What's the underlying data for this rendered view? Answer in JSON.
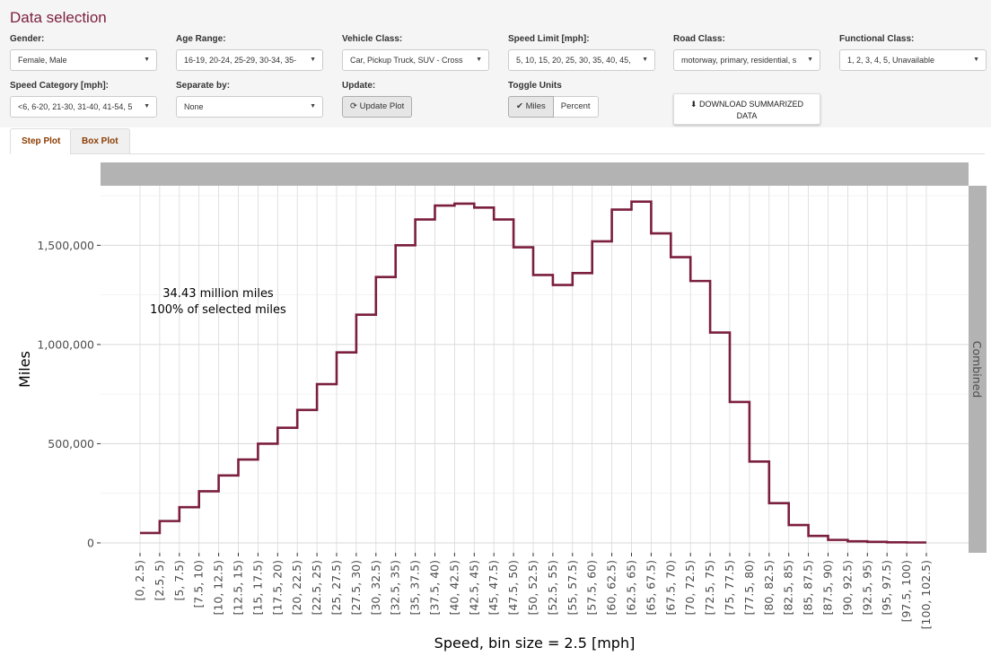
{
  "panel": {
    "title": "Data selection",
    "controls": [
      {
        "label": "Gender:",
        "value": "Female, Male"
      },
      {
        "label": "Age Range:",
        "value": "16-19, 20-24, 25-29, 30-34, 35-"
      },
      {
        "label": "Vehicle Class:",
        "value": "Car, Pickup Truck, SUV - Cross"
      },
      {
        "label": "Speed Limit [mph]:",
        "value": "5, 10, 15, 20, 25, 30, 35, 40, 45,"
      },
      {
        "label": "Road Class:",
        "value": "motorway, primary, residential, s"
      },
      {
        "label": "Functional Class:",
        "value": "1, 2, 3, 4, 5, Unavailable"
      },
      {
        "label": "Speed Category [mph]:",
        "value": "<6, 6-20, 21-30, 31-40, 41-54, 5"
      },
      {
        "label": "Separate by:",
        "value": "None"
      }
    ],
    "update_label": "Update:",
    "update_button": "Update Plot",
    "toggle_label": "Toggle Units",
    "toggle_options": [
      "Miles",
      "Percent"
    ],
    "download_button_line1": "DOWNLOAD SUMMARIZED",
    "download_button_line2": "DATA"
  },
  "tabs": [
    "Step Plot",
    "Box Plot"
  ],
  "icons": {
    "caret": "caret-down-icon",
    "refresh": "refresh-icon",
    "check": "check-icon",
    "download": "download-icon"
  },
  "colors": {
    "accent": "#7b1f3e",
    "line": "#7b1f3e",
    "strip": "#b3b3b3",
    "grid": "#d9d9d9"
  },
  "chart_data": {
    "type": "line",
    "step": true,
    "xlabel": "Speed, bin size = 2.5 [mph]",
    "ylabel": "Miles",
    "facet_label": "Combined",
    "annotation": [
      "34.43 million miles",
      "100% of selected miles"
    ],
    "ylim": [
      -50000,
      1800000
    ],
    "yticks": [
      0,
      500000,
      1000000,
      1500000
    ],
    "ytick_labels": [
      "0",
      "500,000",
      "1,000,000",
      "1,500,000"
    ],
    "categories": [
      "[0, 2.5)",
      "[2.5, 5)",
      "[5, 7.5)",
      "[7.5, 10)",
      "[10, 12.5)",
      "[12.5, 15)",
      "[15, 17.5)",
      "[17.5, 20)",
      "[20, 22.5)",
      "[22.5, 25)",
      "[25, 27.5)",
      "[27.5, 30)",
      "[30, 32.5)",
      "[32.5, 35)",
      "[35, 37.5)",
      "[37.5, 40)",
      "[40, 42.5)",
      "[42.5, 45)",
      "[45, 47.5)",
      "[47.5, 50)",
      "[50, 52.5)",
      "[52.5, 55)",
      "[55, 57.5)",
      "[57.5, 60)",
      "[60, 62.5)",
      "[62.5, 65)",
      "[65, 67.5)",
      "[67.5, 70)",
      "[70, 72.5)",
      "[72.5, 75)",
      "[75, 77.5)",
      "[77.5, 80)",
      "[80, 82.5)",
      "[82.5, 85)",
      "[85, 87.5)",
      "[87.5, 90)",
      "[90, 92.5)",
      "[92.5, 95)",
      "[95, 97.5)",
      "[97.5, 100)",
      "[100, 102.5)"
    ],
    "values": [
      50000,
      110000,
      180000,
      260000,
      340000,
      420000,
      500000,
      580000,
      670000,
      800000,
      960000,
      1150000,
      1340000,
      1500000,
      1630000,
      1700000,
      1710000,
      1690000,
      1630000,
      1490000,
      1350000,
      1300000,
      1360000,
      1520000,
      1680000,
      1720000,
      1560000,
      1440000,
      1320000,
      1060000,
      710000,
      410000,
      200000,
      90000,
      35000,
      15000,
      8000,
      5000,
      3000,
      2000
    ]
  }
}
